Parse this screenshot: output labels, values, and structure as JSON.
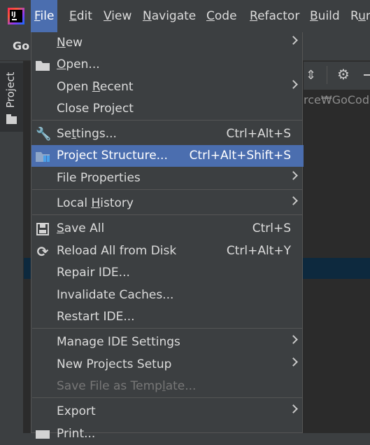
{
  "menubar": {
    "app_icon_text": "IJ",
    "items": [
      {
        "label": "File",
        "mnemonic": "F",
        "rest": "ile"
      },
      {
        "label": "Edit",
        "mnemonic": "E",
        "rest": "dit"
      },
      {
        "label": "View",
        "mnemonic": "V",
        "rest": "iew"
      },
      {
        "label": "Navigate",
        "mnemonic": "N",
        "rest": "avigate"
      },
      {
        "label": "Code",
        "mnemonic": "C",
        "rest": "ode"
      },
      {
        "label": "Refactor",
        "mnemonic": "R",
        "rest": "efactor"
      },
      {
        "label": "Build",
        "mnemonic": "B",
        "rest": "uild"
      },
      {
        "label": "Run",
        "mnemonic": "u",
        "pre": "R",
        "rest": "n"
      }
    ]
  },
  "toolbar": {
    "project_name_partial": "Go"
  },
  "side_panel": {
    "tab_label": "Project"
  },
  "editor": {
    "path_partial": "rce₩GoCod"
  },
  "file_menu": {
    "items": [
      {
        "key": "new",
        "pre": "",
        "mn": "N",
        "post": "ew",
        "shortcut": "",
        "submenu": true,
        "icon": ""
      },
      {
        "key": "open",
        "pre": "",
        "mn": "O",
        "post": "pen...",
        "shortcut": "",
        "submenu": false,
        "icon": "open-folder-icon"
      },
      {
        "key": "open_recent",
        "pre": "Open ",
        "mn": "R",
        "post": "ecent",
        "shortcut": "",
        "submenu": true,
        "icon": ""
      },
      {
        "key": "close_project",
        "pre": "Close Project",
        "mn": "",
        "post": "",
        "shortcut": "",
        "submenu": false,
        "icon": ""
      },
      {
        "key": "settings",
        "pre": "Se",
        "mn": "t",
        "post": "tings...",
        "shortcut": "Ctrl+Alt+S",
        "submenu": false,
        "icon": "wrench-icon"
      },
      {
        "key": "project_structure",
        "pre": "Project Structure...",
        "mn": "",
        "post": "",
        "shortcut": "Ctrl+Alt+Shift+S",
        "submenu": false,
        "icon": "project-structure-icon"
      },
      {
        "key": "file_properties",
        "pre": "File Properties",
        "mn": "",
        "post": "",
        "shortcut": "",
        "submenu": true,
        "icon": ""
      },
      {
        "key": "local_history",
        "pre": "Local ",
        "mn": "H",
        "post": "istory",
        "shortcut": "",
        "submenu": true,
        "icon": ""
      },
      {
        "key": "save_all",
        "pre": "",
        "mn": "S",
        "post": "ave All",
        "shortcut": "Ctrl+S",
        "submenu": false,
        "icon": "save-icon"
      },
      {
        "key": "reload_all",
        "pre": "Reload All from Disk",
        "mn": "",
        "post": "",
        "shortcut": "Ctrl+Alt+Y",
        "submenu": false,
        "icon": "reload-icon"
      },
      {
        "key": "repair_ide",
        "pre": "Repair IDE...",
        "mn": "",
        "post": "",
        "shortcut": "",
        "submenu": false,
        "icon": ""
      },
      {
        "key": "invalidate_caches",
        "pre": "Invalidate Caches...",
        "mn": "",
        "post": "",
        "shortcut": "",
        "submenu": false,
        "icon": ""
      },
      {
        "key": "restart_ide",
        "pre": "Restart IDE...",
        "mn": "",
        "post": "",
        "shortcut": "",
        "submenu": false,
        "icon": ""
      },
      {
        "key": "manage_ide_settings",
        "pre": "Manage IDE Settings",
        "mn": "",
        "post": "",
        "shortcut": "",
        "submenu": true,
        "icon": ""
      },
      {
        "key": "new_projects_setup",
        "pre": "New Projects Setup",
        "mn": "",
        "post": "",
        "shortcut": "",
        "submenu": true,
        "icon": ""
      },
      {
        "key": "save_file_as_template",
        "pre": "Save File as Temp",
        "mn": "l",
        "post": "ate...",
        "shortcut": "",
        "submenu": false,
        "icon": ""
      },
      {
        "key": "export",
        "pre": "Export",
        "mn": "",
        "post": "",
        "shortcut": "",
        "submenu": true,
        "icon": ""
      },
      {
        "key": "print",
        "pre": "Print...",
        "mn": "",
        "post": "",
        "shortcut": "",
        "submenu": false,
        "icon": "print-icon"
      }
    ]
  }
}
